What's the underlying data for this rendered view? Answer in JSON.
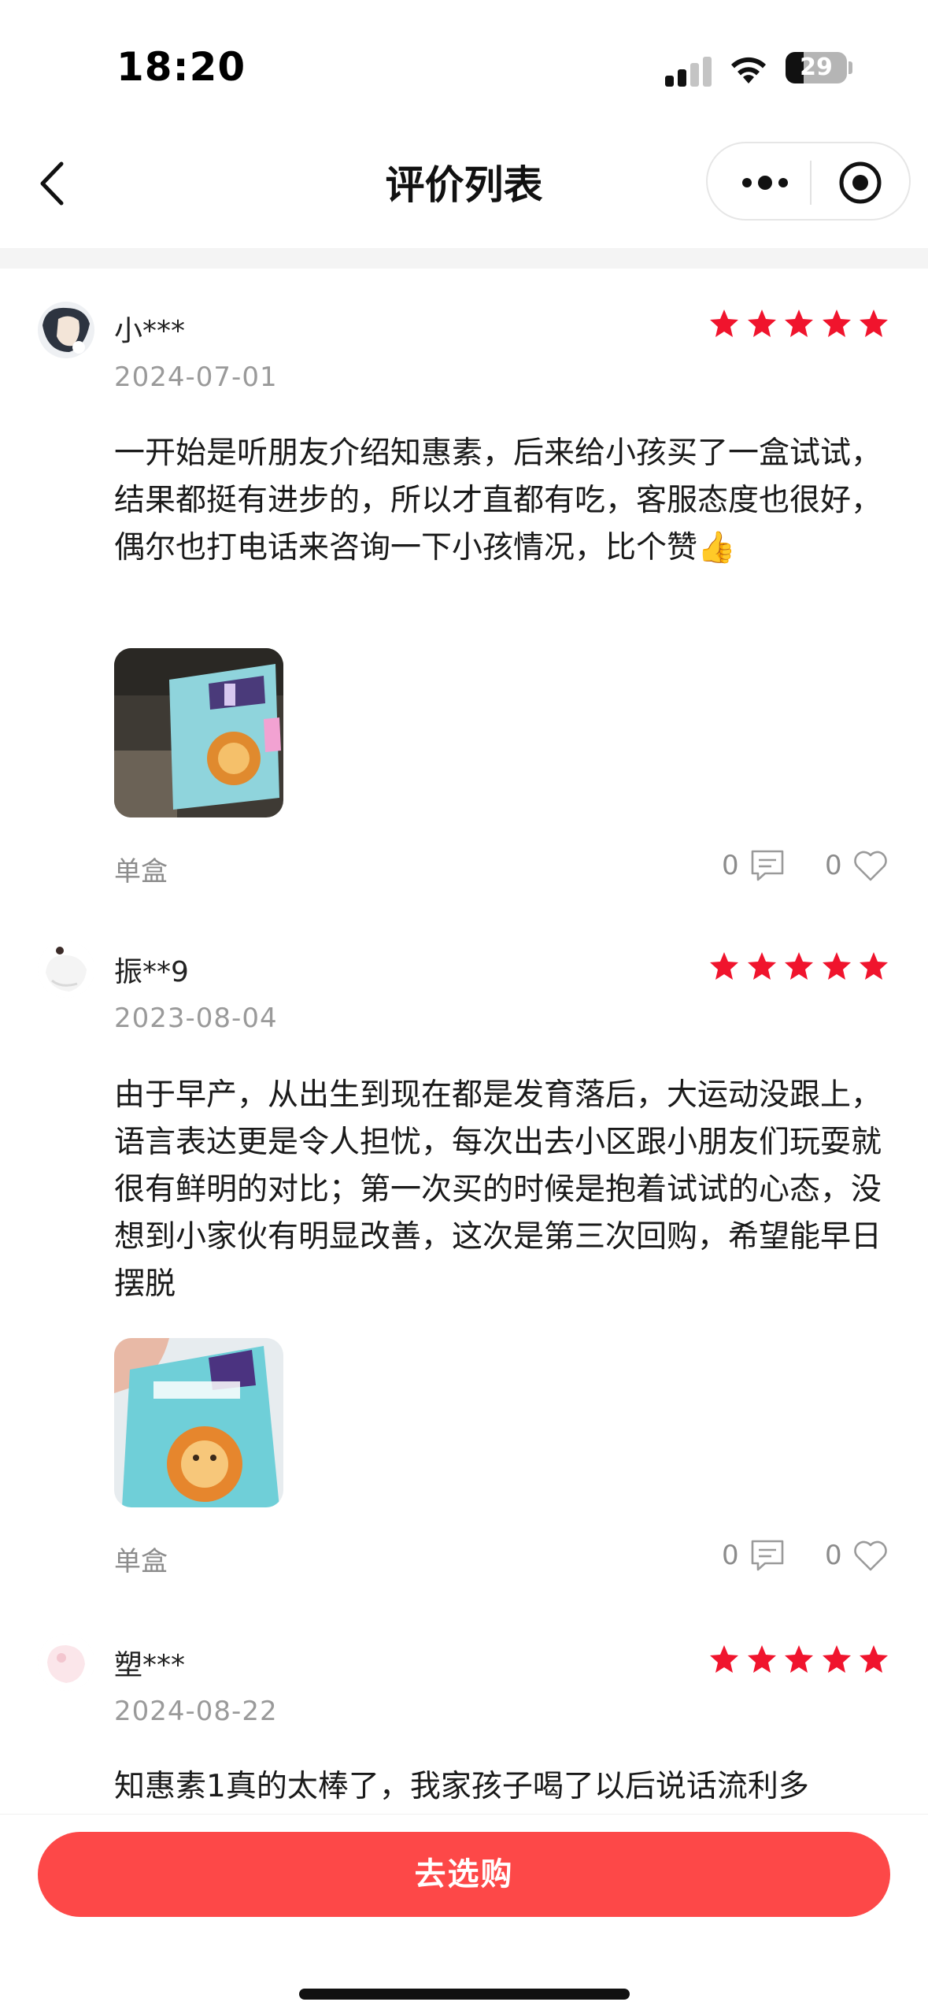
{
  "status_bar": {
    "time": "18:20",
    "battery": "29",
    "battery_level": 0.29
  },
  "nav": {
    "title": "评价列表"
  },
  "colors": {
    "accent": "#fd4848",
    "star": "#f0142d",
    "muted": "#9a9a9a"
  },
  "reviews": [
    {
      "name": "小***",
      "date": "2024-07-01",
      "rating": 5,
      "text": "一开始是听朋友介绍知惠素，后来给小孩买了一盒试试，结果都挺有进步的，所以才直都有吃，客服态度也很好，偶尔也打电话来咨询一下小孩情况，比个赞👍",
      "spec": "单盒",
      "comments": "0",
      "likes": "0"
    },
    {
      "name": "振**9",
      "date": "2023-08-04",
      "rating": 5,
      "text": "由于早产，从出生到现在都是发育落后，大运动没跟上，语言表达更是令人担忧，每次出去小区跟小朋友们玩耍就很有鲜明的对比；第一次买的时候是抱着试试的心态，没想到小家伙有明显改善，这次是第三次回购，希望能早日摆脱",
      "spec": "单盒",
      "comments": "0",
      "likes": "0"
    },
    {
      "name": "塑***",
      "date": "2024-08-22",
      "rating": 5,
      "text": "知惠素1真的太棒了，我家孩子喝了以后说话流利多"
    }
  ],
  "bottom": {
    "buy_label": "去选购"
  }
}
